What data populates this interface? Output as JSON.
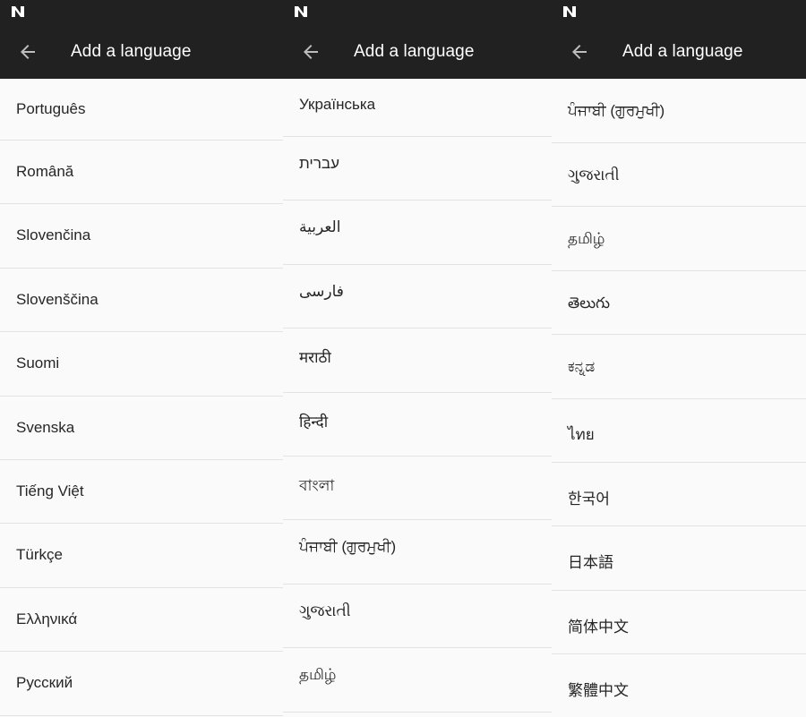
{
  "colors": {
    "bar": "#212121",
    "list_bg": "#fafafa",
    "divider": "#e3e3e3",
    "text": "#262626",
    "title": "#ffffff"
  },
  "screens": [
    {
      "title": "Add a language",
      "items": [
        "Português",
        "Română",
        "Slovenčina",
        "Slovenščina",
        "Suomi",
        "Svenska",
        "Tiếng Việt",
        "Türkçe",
        "Ελληνικά",
        "Русский"
      ]
    },
    {
      "title": "Add a language",
      "items": [
        "Українська",
        "עברית",
        "العربية",
        "فارسی",
        "मराठी",
        "हिन्दी",
        "বাংলা",
        "ਪੰਜਾਬੀ (ਗੁਰਮੁਖੀ)",
        "ગુજરાતી",
        "தமிழ்"
      ]
    },
    {
      "title": "Add a language",
      "items": [
        "ਪੰਜਾਬੀ (ਗੁਰਮੁਖੀ)",
        "ગુજરાતી",
        "தமிழ்",
        "తెలుగు",
        "ಕನ್ನಡ",
        "ไทย",
        "한국어",
        "日本語",
        "简体中文",
        "繁體中文"
      ]
    }
  ]
}
